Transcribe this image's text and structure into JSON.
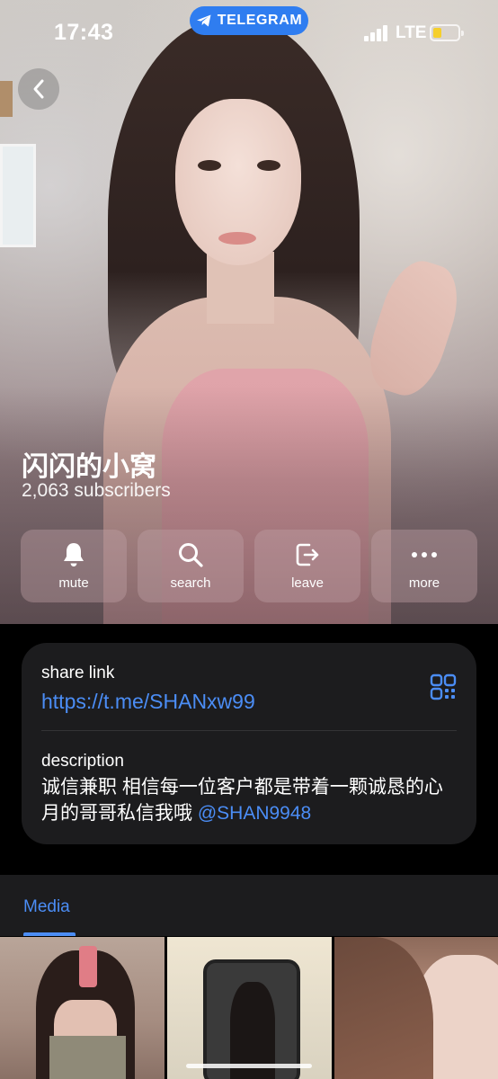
{
  "status_bar": {
    "time": "17:43",
    "app_pill": "TELEGRAM",
    "network": "LTE"
  },
  "channel": {
    "title": "闪闪的小窝",
    "subscribers": "2,063 subscribers"
  },
  "actions": [
    {
      "label": "mute",
      "icon": "bell-icon"
    },
    {
      "label": "search",
      "icon": "search-icon"
    },
    {
      "label": "leave",
      "icon": "leave-icon"
    },
    {
      "label": "more",
      "icon": "more-icon"
    }
  ],
  "info": {
    "share_label": "share link",
    "share_url": "https://t.me/SHANxw99",
    "description_label": "description",
    "description_text": "诚信兼职 相信每一位客户都是带着一颗诚恳的心 月的哥哥私信我哦 ",
    "description_mention": "@SHAN9948"
  },
  "media": {
    "tab_label": "Media"
  },
  "colors": {
    "accent": "#4b8df5",
    "telegram_pill": "#2f7df0",
    "card_bg": "#1c1c1e",
    "battery": "#f5cf2b"
  }
}
